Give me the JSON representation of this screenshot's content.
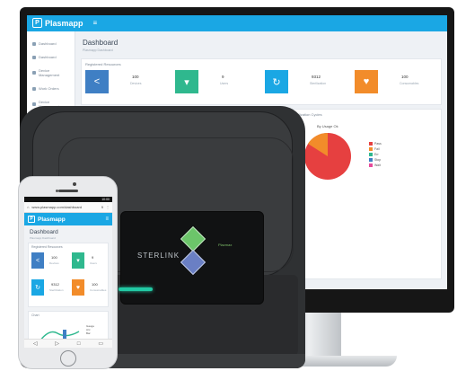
{
  "brand": {
    "name": "Plasmapp",
    "color": "#1aa7e4"
  },
  "monitor": {
    "page_title": "Dashboard",
    "page_subtitle": "Plasmapp Dashboard",
    "panel_label": "Registered Resources",
    "sidebar": [
      {
        "label": "Dashboard"
      },
      {
        "label": "Dashboard"
      },
      {
        "label": "Device Management"
      },
      {
        "label": "Work Orders"
      },
      {
        "label": "Device Management"
      },
      {
        "label": "Reports"
      }
    ],
    "cards": [
      {
        "value": "100",
        "label": "Devices",
        "color": "#3f7fc4",
        "icon": "share-icon"
      },
      {
        "value": "9",
        "label": "Users",
        "color": "#2fb88e",
        "icon": "shirt-icon"
      },
      {
        "value": "9312",
        "label": "Sterilization",
        "color": "#1aa7e4",
        "icon": "cycle-icon"
      },
      {
        "value": "100",
        "label": "Consumables",
        "color": "#f28c2a",
        "icon": "heart-icon"
      }
    ],
    "lower_right_label": "Recent Sterilization Cycles",
    "pie_label": "By Usage Ok",
    "pie_legend": [
      {
        "label": "Pass",
        "color": "#e64040"
      },
      {
        "label": "Fail",
        "color": "#f28c2a"
      },
      {
        "label": "Err",
        "color": "#2fb88e"
      },
      {
        "label": "Stop",
        "color": "#3f7fc4"
      },
      {
        "label": "Wait",
        "color": "#e64b9a"
      }
    ]
  },
  "device": {
    "brand_text": "STERLINK",
    "product_name": "Plazmax",
    "led_color": "#22c9a4"
  },
  "phone": {
    "status_text": "10:00",
    "url": "www.plasmapp.com/dashboard",
    "tab_count": "9",
    "page_title": "Dashboard",
    "page_subtitle": "Plasmapp Dashboard",
    "panel_label": "Registered Resources",
    "cards": [
      {
        "value": "100",
        "label": "Devices",
        "color": "#3f7fc4",
        "icon": "share-icon"
      },
      {
        "value": "9",
        "label": "Users",
        "color": "#2fb88e",
        "icon": "shirt-icon"
      },
      {
        "value": "9312",
        "label": "Sterilization",
        "color": "#1aa7e4",
        "icon": "cycle-icon"
      },
      {
        "value": "100",
        "label": "Consumables",
        "color": "#f28c2a",
        "icon": "heart-icon"
      }
    ],
    "chart_label": "Chart",
    "chart_legend": [
      {
        "label": "Gauge",
        "color": "#2fb88e"
      },
      {
        "label": "Arc",
        "color": "#3f7fc4"
      },
      {
        "label": "Bar",
        "color": "#f2c12a"
      }
    ],
    "nav": [
      "Back",
      "Forward",
      "Menu",
      "Tabs"
    ]
  }
}
